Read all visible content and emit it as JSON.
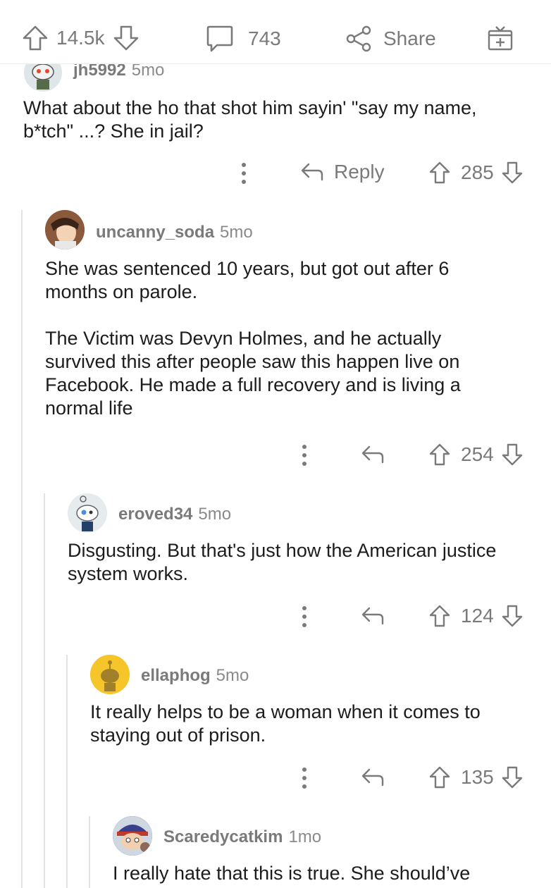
{
  "topbar": {
    "upvotes": "14.5k",
    "comments": "743",
    "share_label": "Share"
  },
  "comments": [
    {
      "author": "jh5992",
      "age": "5mo",
      "paragraphs": [
        "What about the ho that shot him sayin' \"say my name, b*tch\" ...? She in jail?"
      ],
      "reply_label": "Reply",
      "score": "285"
    },
    {
      "author": "uncanny_soda",
      "age": "5mo",
      "paragraphs": [
        "She was sentenced 10 years, but got out after 6 months on parole.",
        "The Victim was Devyn Holmes, and he actually survived this after people saw this happen live on Facebook. He made a full recovery and is living a normal life"
      ],
      "score": "254"
    },
    {
      "author": "eroved34",
      "age": "5mo",
      "paragraphs": [
        "Disgusting. But that's just how the American justice system works."
      ],
      "score": "124"
    },
    {
      "author": "ellaphog",
      "age": "5mo",
      "paragraphs": [
        "It really helps to be a woman when it comes to staying out of prison."
      ],
      "score": "135"
    },
    {
      "author": "Scaredycatkim",
      "age": "1mo",
      "paragraphs": [
        "I really hate that this is true. She should’ve"
      ]
    }
  ],
  "colors": {
    "muted": "#7a7a7a",
    "thread_line": "#e3e3e3",
    "text": "#1c1c1c"
  }
}
